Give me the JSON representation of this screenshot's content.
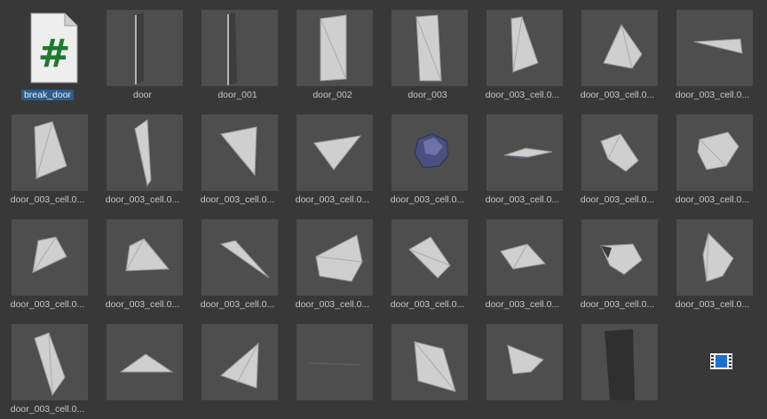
{
  "assets": [
    {
      "name": "break_door",
      "type": "script",
      "selected": true,
      "icon": "csharp-script-icon"
    },
    {
      "name": "door",
      "type": "mesh",
      "icon": "door-mesh-icon"
    },
    {
      "name": "door_001",
      "type": "mesh",
      "icon": "door-mesh-icon"
    },
    {
      "name": "door_002",
      "type": "mesh",
      "icon": "door-panel-icon"
    },
    {
      "name": "door_003",
      "type": "mesh",
      "icon": "door-panel-icon"
    },
    {
      "name": "door_003_cell.0...",
      "type": "mesh",
      "icon": "fragment-icon"
    },
    {
      "name": "door_003_cell.0...",
      "type": "mesh",
      "icon": "fragment-icon"
    },
    {
      "name": "door_003_cell.0...",
      "type": "mesh",
      "icon": "fragment-icon"
    },
    {
      "name": "door_003_cell.0...",
      "type": "mesh",
      "icon": "fragment-icon"
    },
    {
      "name": "door_003_cell.0...",
      "type": "mesh",
      "icon": "fragment-icon"
    },
    {
      "name": "door_003_cell.0...",
      "type": "mesh",
      "icon": "fragment-icon"
    },
    {
      "name": "door_003_cell.0...",
      "type": "mesh",
      "icon": "fragment-icon"
    },
    {
      "name": "door_003_cell.0...",
      "type": "mesh",
      "icon": "fragment-icon"
    },
    {
      "name": "door_003_cell.0...",
      "type": "mesh",
      "icon": "fragment-icon"
    },
    {
      "name": "door_003_cell.0...",
      "type": "mesh",
      "icon": "fragment-icon"
    },
    {
      "name": "door_003_cell.0...",
      "type": "mesh",
      "icon": "fragment-icon"
    },
    {
      "name": "door_003_cell.0...",
      "type": "mesh",
      "icon": "fragment-icon"
    },
    {
      "name": "door_003_cell.0...",
      "type": "mesh",
      "icon": "fragment-icon"
    },
    {
      "name": "door_003_cell.0...",
      "type": "mesh",
      "icon": "fragment-icon"
    },
    {
      "name": "door_003_cell.0...",
      "type": "mesh",
      "icon": "fragment-icon"
    },
    {
      "name": "door_003_cell.0...",
      "type": "mesh",
      "icon": "fragment-icon"
    },
    {
      "name": "door_003_cell.0...",
      "type": "mesh",
      "icon": "fragment-icon"
    },
    {
      "name": "door_003_cell.0...",
      "type": "mesh",
      "icon": "fragment-icon"
    },
    {
      "name": "door_003_cell.0...",
      "type": "mesh",
      "icon": "fragment-icon"
    },
    {
      "name": "door_003_cell.0...",
      "type": "mesh",
      "icon": "fragment-icon"
    },
    {
      "name": "",
      "type": "mesh",
      "icon": "fragment-icon"
    },
    {
      "name": "",
      "type": "mesh",
      "icon": "fragment-icon"
    },
    {
      "name": "",
      "type": "mesh",
      "icon": "fragment-icon"
    },
    {
      "name": "",
      "type": "mesh",
      "icon": "fragment-icon"
    },
    {
      "name": "",
      "type": "mesh",
      "icon": "fragment-icon"
    },
    {
      "name": "",
      "type": "mesh",
      "icon": "fragment-icon"
    },
    {
      "name": "",
      "type": "mesh",
      "icon": "door-mesh-icon"
    }
  ],
  "trailing_icon": "film-strip-icon",
  "colors": {
    "background": "#383838",
    "thumb": "#4e4e4e",
    "selection": "#2c5d8a",
    "mesh": "#c9c9c9"
  }
}
